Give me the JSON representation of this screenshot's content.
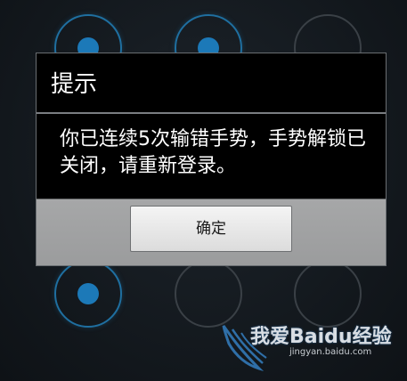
{
  "pattern": {
    "nodes": [
      {
        "row": 0,
        "col": 0,
        "active": true
      },
      {
        "row": 0,
        "col": 1,
        "active": true
      },
      {
        "row": 0,
        "col": 2,
        "active": false
      },
      {
        "row": 2,
        "col": 0,
        "active": true
      },
      {
        "row": 2,
        "col": 1,
        "active": false
      },
      {
        "row": 2,
        "col": 2,
        "active": false
      }
    ],
    "accent_color": "#1c79b8"
  },
  "dialog": {
    "title": "提示",
    "message": "你已连续5次输错手势，手势解锁已关闭，请重新登录。",
    "confirm_label": "确定"
  },
  "watermark": {
    "text": "我爱Baidu经验",
    "url": "jingyan.baidu.com"
  }
}
